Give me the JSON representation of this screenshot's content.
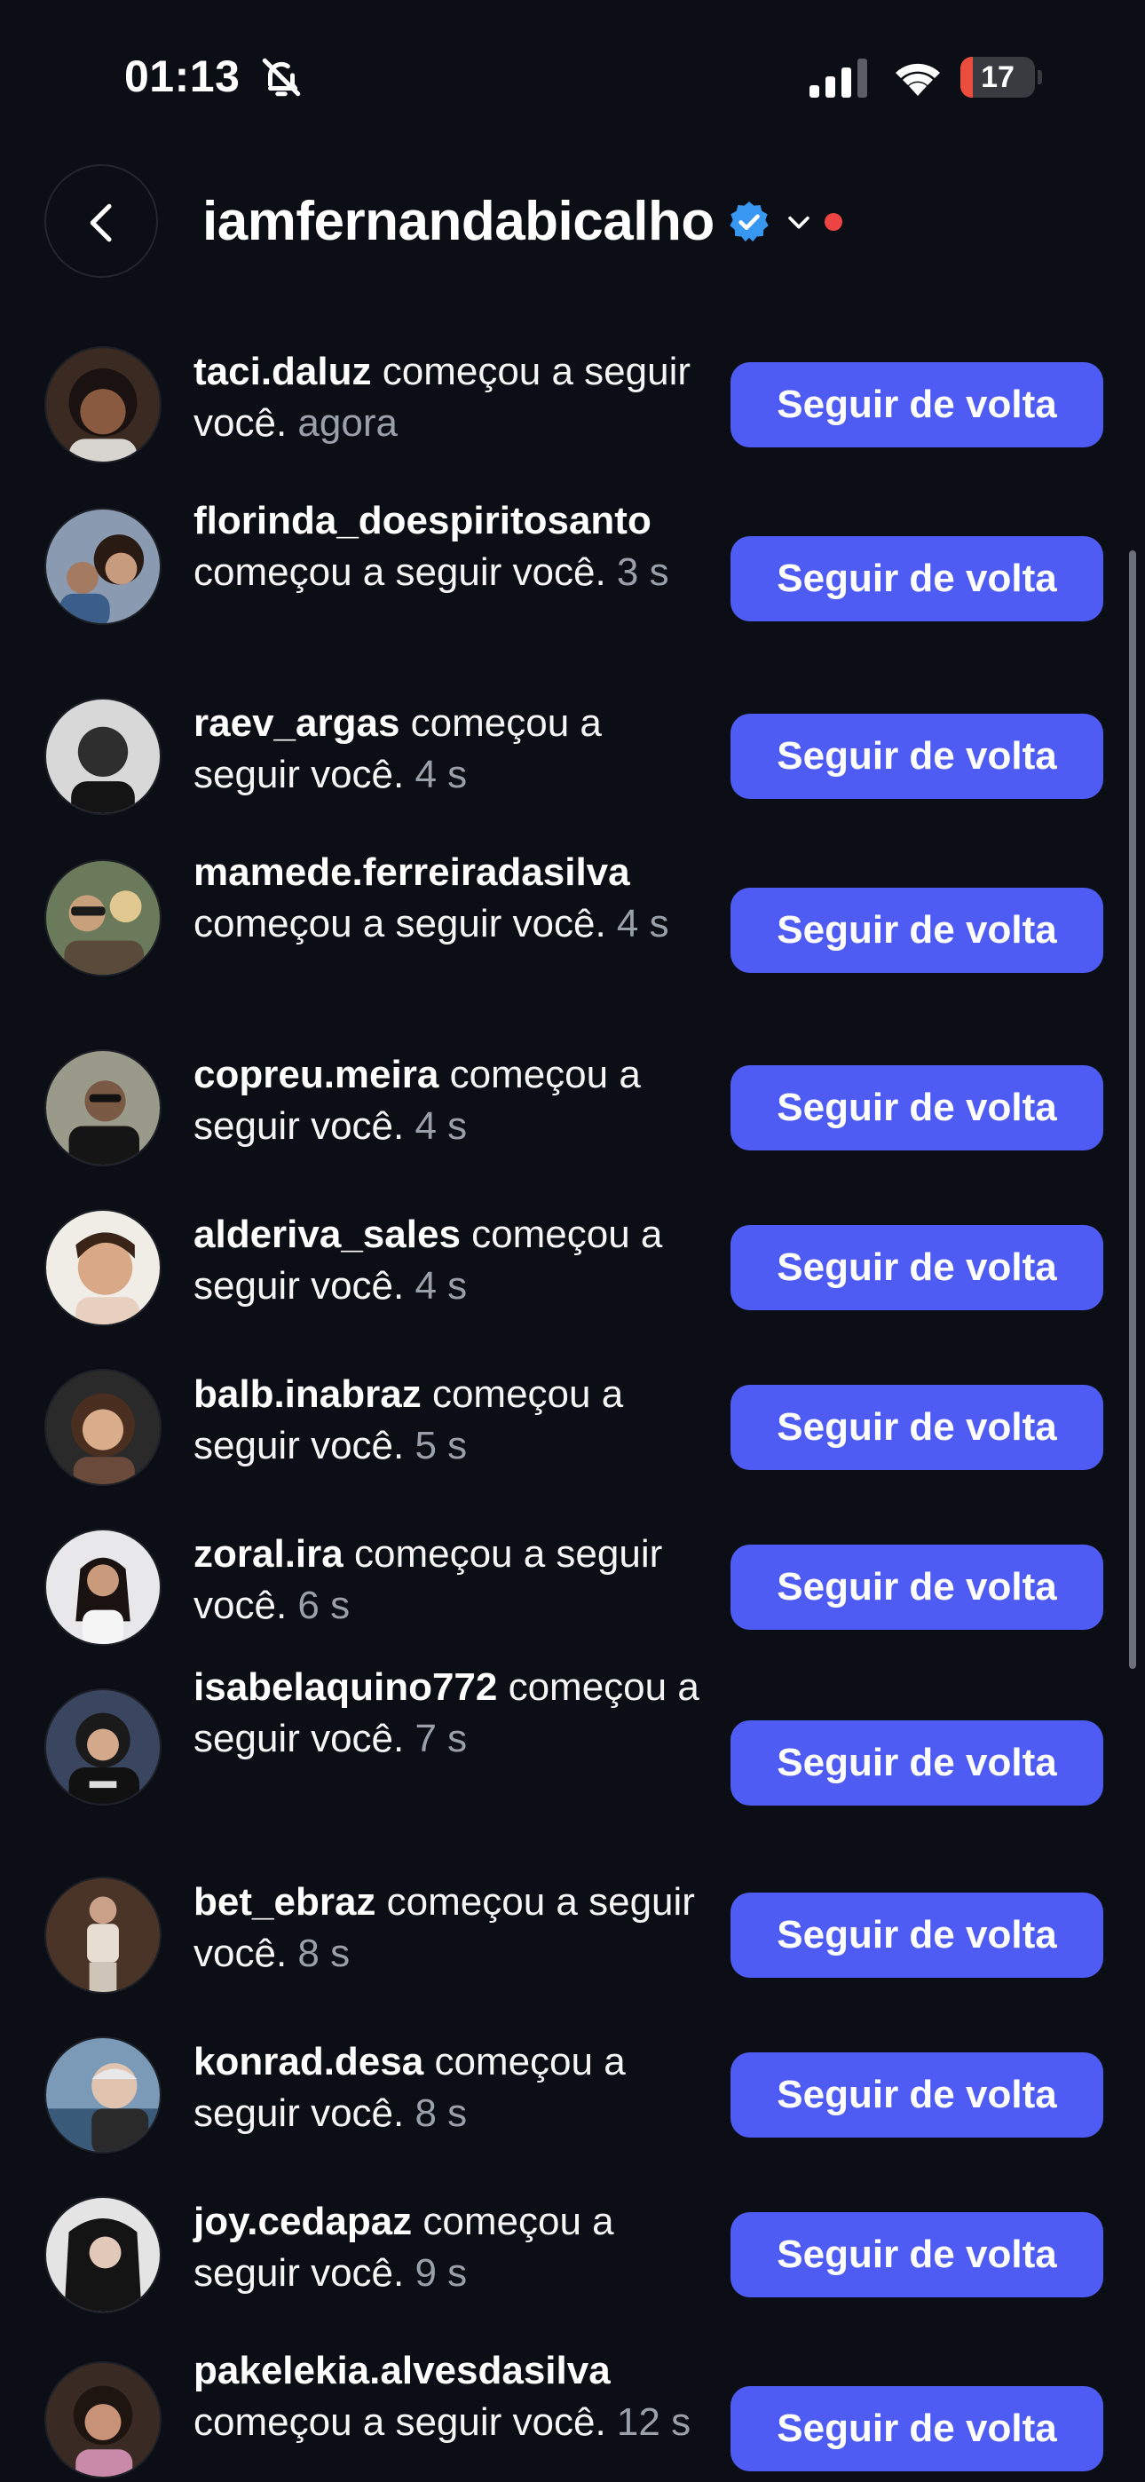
{
  "status_bar": {
    "time": "01:13",
    "battery": "17",
    "battery_level": 0.17,
    "icons": [
      "bell-slash-icon",
      "cellular-signal-icon",
      "wifi-icon",
      "battery-icon"
    ]
  },
  "header": {
    "title": "iamfernandabicalho",
    "icons": [
      "back-arrow-icon",
      "verified-badge-icon",
      "chevron-down-icon"
    ]
  },
  "colors": {
    "background": "#0b0e14",
    "button": "#4f5cf4",
    "verified": "#3897f0",
    "notification_dot": "#ef4444",
    "muted_text": "#9aa0a9"
  },
  "notifications": [
    {
      "username": "taci.daluz",
      "action": " começou a seguir você.",
      "time": "agora",
      "button": "Seguir de volta"
    },
    {
      "username": "florinda_doespiritosanto",
      "action": " começou a seguir você.",
      "time": "3 s",
      "button": "Seguir de volta"
    },
    {
      "username": "raev_argas",
      "action": " começou a seguir você.",
      "time": "4 s",
      "button": "Seguir de volta"
    },
    {
      "username": "mamede.ferreiradasilva",
      "action": " começou a seguir você.",
      "time": "4 s",
      "button": "Seguir de volta"
    },
    {
      "username": "copreu.meira",
      "action": " começou a seguir você.",
      "time": "4 s",
      "button": "Seguir de volta"
    },
    {
      "username": "alderiva_sales",
      "action": " começou a seguir você.",
      "time": "4 s",
      "button": "Seguir de volta"
    },
    {
      "username": "balb.inabraz",
      "action": " começou a seguir você.",
      "time": "5 s",
      "button": "Seguir de volta"
    },
    {
      "username": "zoral.ira",
      "action": " começou a seguir você.",
      "time": "6 s",
      "button": "Seguir de volta"
    },
    {
      "username": "isabelaquino772",
      "action": " começou a seguir você.",
      "time": "7 s",
      "button": "Seguir de volta"
    },
    {
      "username": "bet_ebraz",
      "action": " começou a seguir você.",
      "time": "8 s",
      "button": "Seguir de volta"
    },
    {
      "username": "konrad.desa",
      "action": " começou a seguir você.",
      "time": "8 s",
      "button": "Seguir de volta"
    },
    {
      "username": "joy.cedapaz",
      "action": " começou a seguir você.",
      "time": "9 s",
      "button": "Seguir de volta"
    },
    {
      "username": "pakelekia.alvesdasilva",
      "action": " começou a seguir você.",
      "time": "12 s",
      "button": "Seguir de volta"
    }
  ]
}
